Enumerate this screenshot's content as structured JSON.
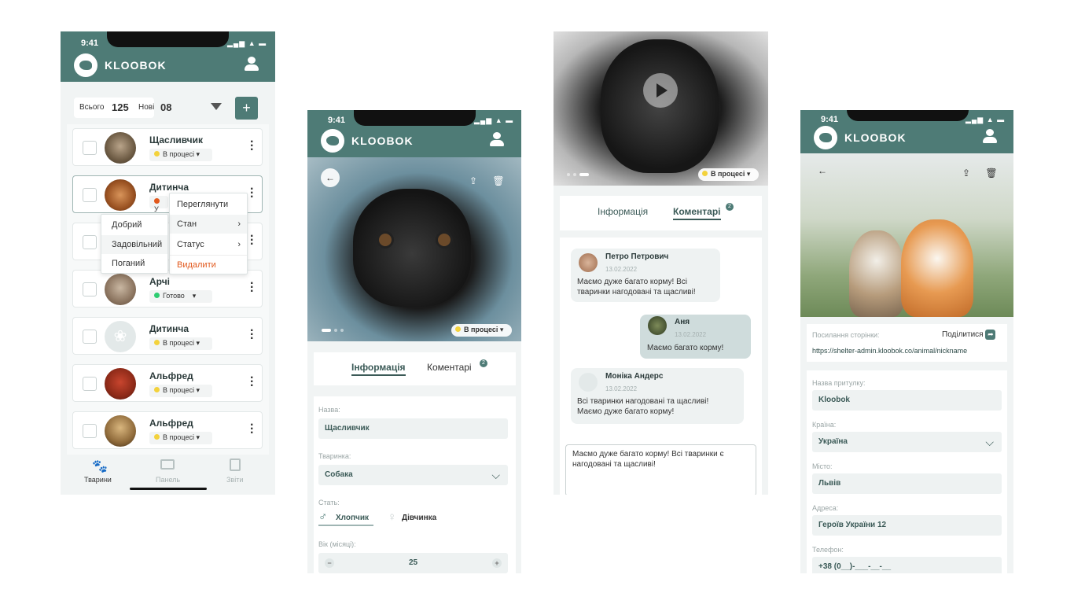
{
  "app": {
    "brand": "KLOOBOK",
    "time": "9:41",
    "signal_icons": "▂▄▆ ▲ ▬"
  },
  "list_screen": {
    "summary": {
      "total_label": "Всього",
      "total_value": "125",
      "new_label": "Нові",
      "new_value": "08"
    },
    "rows": [
      {
        "name": "Щасливчик",
        "status": "В процесі",
        "status_color": "#f3d23c"
      },
      {
        "name": "Дитинча",
        "status": "У",
        "status_color": "#e2591d"
      },
      {
        "name": "",
        "status": "",
        "status_color": "#cccccc"
      },
      {
        "name": "Арчі",
        "status": "Готово",
        "status_color": "#2ecc71"
      },
      {
        "name": "Дитинча",
        "status": "В процесі",
        "status_color": "#f3d23c"
      },
      {
        "name": "Альфред",
        "status": "В процесі",
        "status_color": "#f3d23c"
      },
      {
        "name": "Альфред",
        "status": "В процесі",
        "status_color": "#f3d23c"
      }
    ],
    "context_menu": {
      "view": "Переглянути",
      "state": "Стан",
      "status": "Статус",
      "delete": "Видалити"
    },
    "submenu": {
      "good": "Добрий",
      "satisfactory": "Задовільний",
      "bad": "Поганий"
    },
    "bottom_nav": {
      "animals": "Тварини",
      "panel": "Панель",
      "reports": "Звіти"
    }
  },
  "info_screen": {
    "status": "В процесі",
    "tabs": {
      "info": "Інформація",
      "comments": "Коментарі",
      "comments_badge": "2"
    },
    "name_label": "Назва:",
    "name_value": "Щасливчик",
    "animal_label": "Тваринка:",
    "animal_value": "Собака",
    "sex_label": "Стать:",
    "male": "Хлопчик",
    "female": "Дівчинка",
    "age_label": "Вік (місяці):",
    "age_value": "25",
    "minus": "−",
    "plus": "+"
  },
  "comments_screen": {
    "status": "В процесі",
    "tabs": {
      "info": "Інформація",
      "comments": "Коментарі",
      "comments_badge": "2"
    },
    "messages": [
      {
        "author": "Петро Петрович",
        "date": "13.02.2022",
        "text": "Маємо дуже багато корму! Всі тваринки нагодовані та щасливі!"
      },
      {
        "author": "Аня",
        "date": "13.02.2022",
        "text": "Маємо багато корму!"
      },
      {
        "author": "Моніка Андерс",
        "date": "13.02.2022",
        "text": "Всі тваринки нагодовані та щасливі! Маємо дуже багато корму!"
      }
    ],
    "draft": "Маємо дуже багато корму! Всі тваринки є нагодовані та щасливі!"
  },
  "shelter_screen": {
    "link_label": "Посилання сторінки:",
    "share": "Поділитися",
    "link": "https://shelter-admin.kloobok.co/animal/nickname",
    "shelter_label": "Назва притулку:",
    "shelter_value": "Kloobok",
    "country_label": "Країна:",
    "country_value": "Україна",
    "city_label": "Місто:",
    "city_value": "Львів",
    "address_label": "Адреса:",
    "address_value": "Героїв України 12",
    "phone_label": "Телефон:",
    "phone_value": "+38 (0__)-___-__-__"
  },
  "colors": {
    "accent": "#4e7b76",
    "bg": "#f1f4f4",
    "danger": "#e2591d"
  }
}
